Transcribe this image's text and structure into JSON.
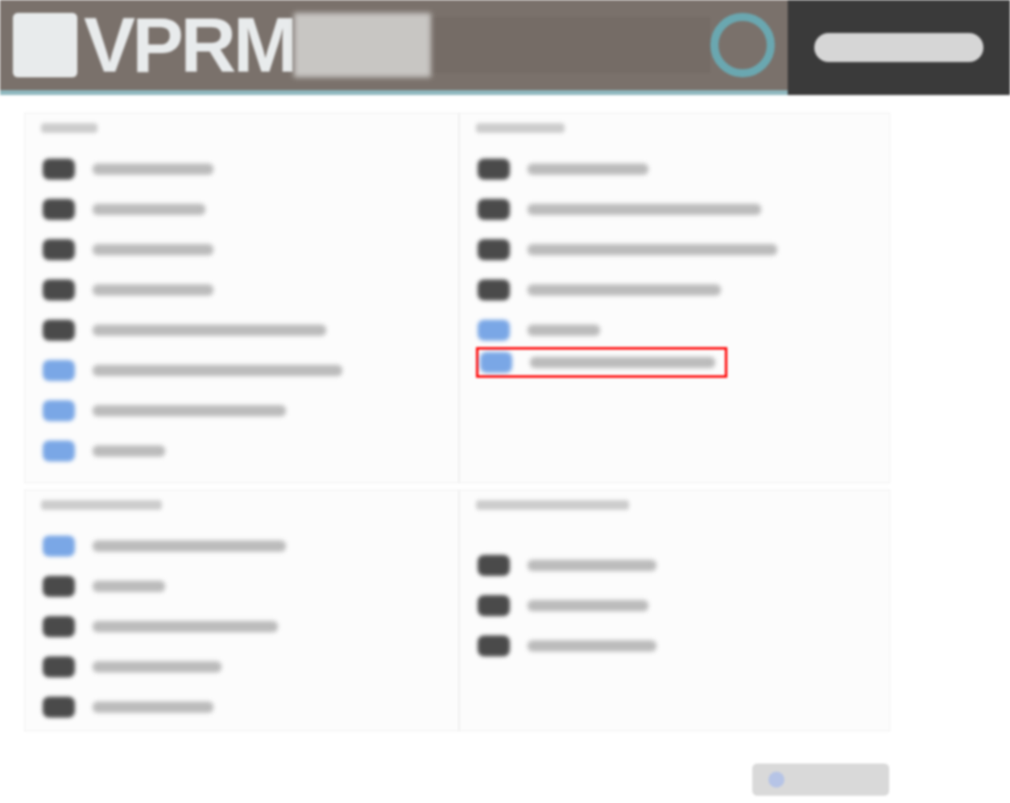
{
  "header": {
    "logo_text": "VPRM"
  },
  "panels": [
    {
      "items": [
        {
          "active": false,
          "marked": false
        },
        {
          "active": false,
          "marked": false
        },
        {
          "active": false,
          "marked": false
        },
        {
          "active": false,
          "marked": false
        },
        {
          "active": false,
          "marked": false
        },
        {
          "active": true,
          "marked": false
        },
        {
          "active": true,
          "marked": false
        },
        {
          "active": true,
          "marked": false
        }
      ]
    },
    {
      "items": [
        {
          "active": false,
          "marked": false
        },
        {
          "active": false,
          "marked": false
        },
        {
          "active": false,
          "marked": false
        },
        {
          "active": false,
          "marked": false
        },
        {
          "active": true,
          "marked": false
        },
        {
          "active": true,
          "marked": true
        }
      ]
    },
    {
      "items": [
        {
          "active": true,
          "marked": false
        },
        {
          "active": false,
          "marked": false
        },
        {
          "active": false,
          "marked": false
        },
        {
          "active": false,
          "marked": false
        },
        {
          "active": false,
          "marked": false
        }
      ]
    },
    {
      "items": [
        {
          "active": false,
          "marked": false
        },
        {
          "active": false,
          "marked": false
        },
        {
          "active": false,
          "marked": false
        }
      ]
    }
  ]
}
